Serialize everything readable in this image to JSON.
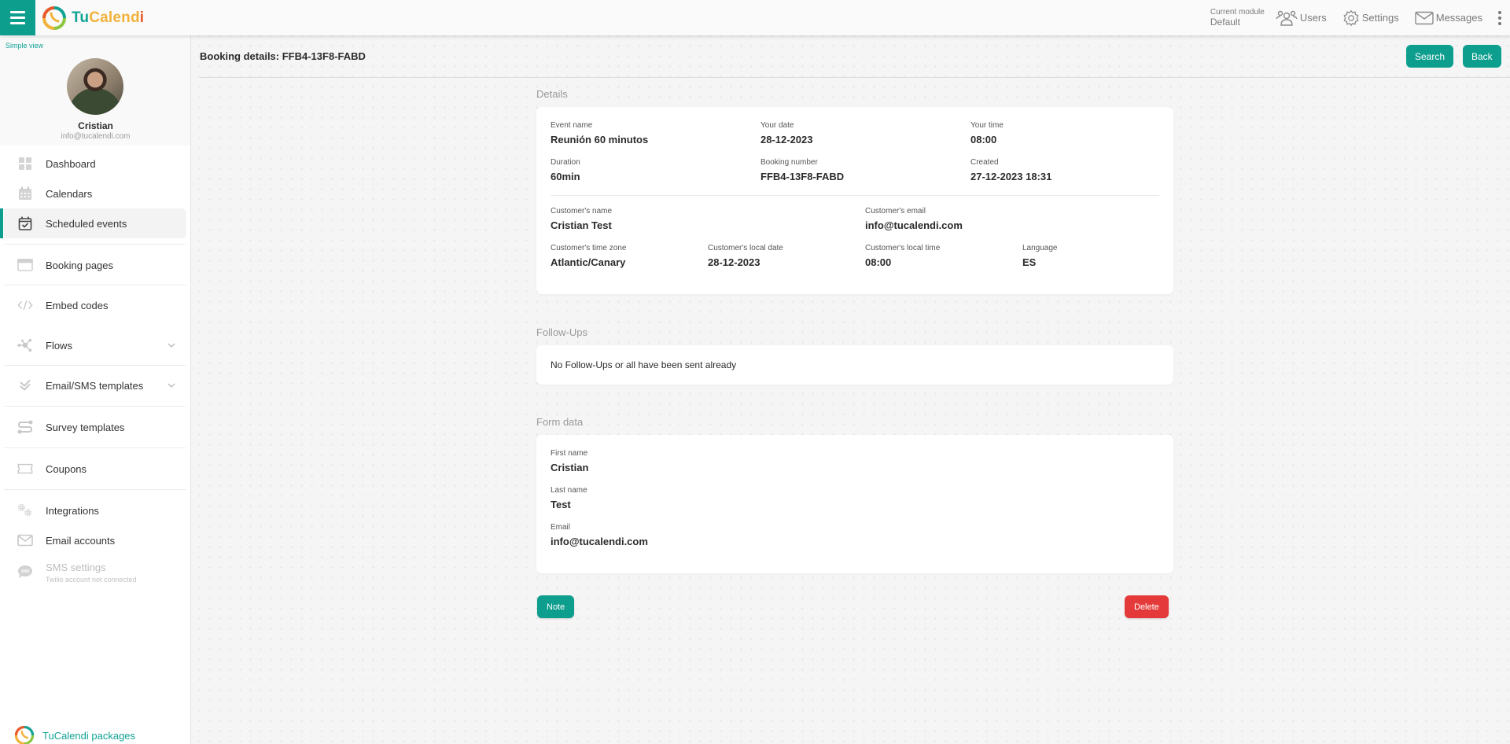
{
  "app": {
    "brand": {
      "part1": "Tu",
      "part2": "Calend",
      "part3": "i"
    },
    "colors": {
      "accent": "#0e9e8e",
      "danger": "#e53a3a",
      "brand_orange": "#f2b23a",
      "brand_red": "#e85a2a"
    }
  },
  "topbar": {
    "module_label": "Current module",
    "module_value": "Default",
    "links": [
      {
        "label": "Users",
        "icon": "users-icon"
      },
      {
        "label": "Settings",
        "icon": "gear-icon"
      },
      {
        "label": "Messages",
        "icon": "envelope-icon"
      }
    ],
    "more_icon": "kebab-menu-icon"
  },
  "sidebar": {
    "simple_view": "Simple view",
    "profile": {
      "name": "Cristian",
      "email": "info@tucalendi.com"
    },
    "items": [
      {
        "label": "Dashboard",
        "icon": "dashboard-icon"
      },
      {
        "label": "Calendars",
        "icon": "calendar-icon"
      },
      {
        "label": "Scheduled events",
        "icon": "calendar-check-icon",
        "active": true
      },
      {
        "label": "Booking pages",
        "icon": "browser-window-icon"
      },
      {
        "label": "Embed codes",
        "icon": "code-icon"
      },
      {
        "label": "Flows",
        "icon": "flows-icon",
        "expandable": true
      },
      {
        "label": "Email/SMS templates",
        "icon": "double-check-icon",
        "expandable": true
      },
      {
        "label": "Survey templates",
        "icon": "survey-icon"
      },
      {
        "label": "Coupons",
        "icon": "ticket-icon"
      },
      {
        "label": "Integrations",
        "icon": "gears-icon"
      },
      {
        "label": "Email accounts",
        "icon": "envelope-icon"
      },
      {
        "label": "SMS settings",
        "icon": "sms-bubble-icon",
        "disabled": true,
        "sublabel": "Twilio account not connected"
      }
    ],
    "packages_label": "TuCalendi packages"
  },
  "main": {
    "title": "Booking details: FFB4-13F8-FABD",
    "buttons": {
      "search": "Search",
      "back": "Back"
    },
    "details": {
      "title": "Details",
      "event_name": {
        "label": "Event name",
        "value": "Reunión 60 minutos"
      },
      "your_date": {
        "label": "Your date",
        "value": "28-12-2023"
      },
      "your_time": {
        "label": "Your time",
        "value": "08:00"
      },
      "duration": {
        "label": "Duration",
        "value": "60min"
      },
      "booking_number": {
        "label": "Booking number",
        "value": "FFB4-13F8-FABD"
      },
      "created": {
        "label": "Created",
        "value": "27-12-2023 18:31"
      },
      "customer_name": {
        "label": "Customer's name",
        "value": "Cristian Test"
      },
      "customer_email": {
        "label": "Customer's email",
        "value": "info@tucalendi.com"
      },
      "customer_tz": {
        "label": "Customer's time zone",
        "value": "Atlantic/Canary"
      },
      "customer_local_date": {
        "label": "Customer's local date",
        "value": "28-12-2023"
      },
      "customer_local_time": {
        "label": "Customer's local time",
        "value": "08:00"
      },
      "language": {
        "label": "Language",
        "value": "ES"
      }
    },
    "followups": {
      "title": "Follow-Ups",
      "empty_text": "No Follow-Ups or all have been sent already"
    },
    "form_data": {
      "title": "Form data",
      "fields": [
        {
          "label": "First name",
          "value": "Cristian"
        },
        {
          "label": "Last name",
          "value": "Test"
        },
        {
          "label": "Email",
          "value": "info@tucalendi.com"
        }
      ]
    },
    "actions": {
      "note": "Note",
      "delete": "Delete"
    }
  }
}
